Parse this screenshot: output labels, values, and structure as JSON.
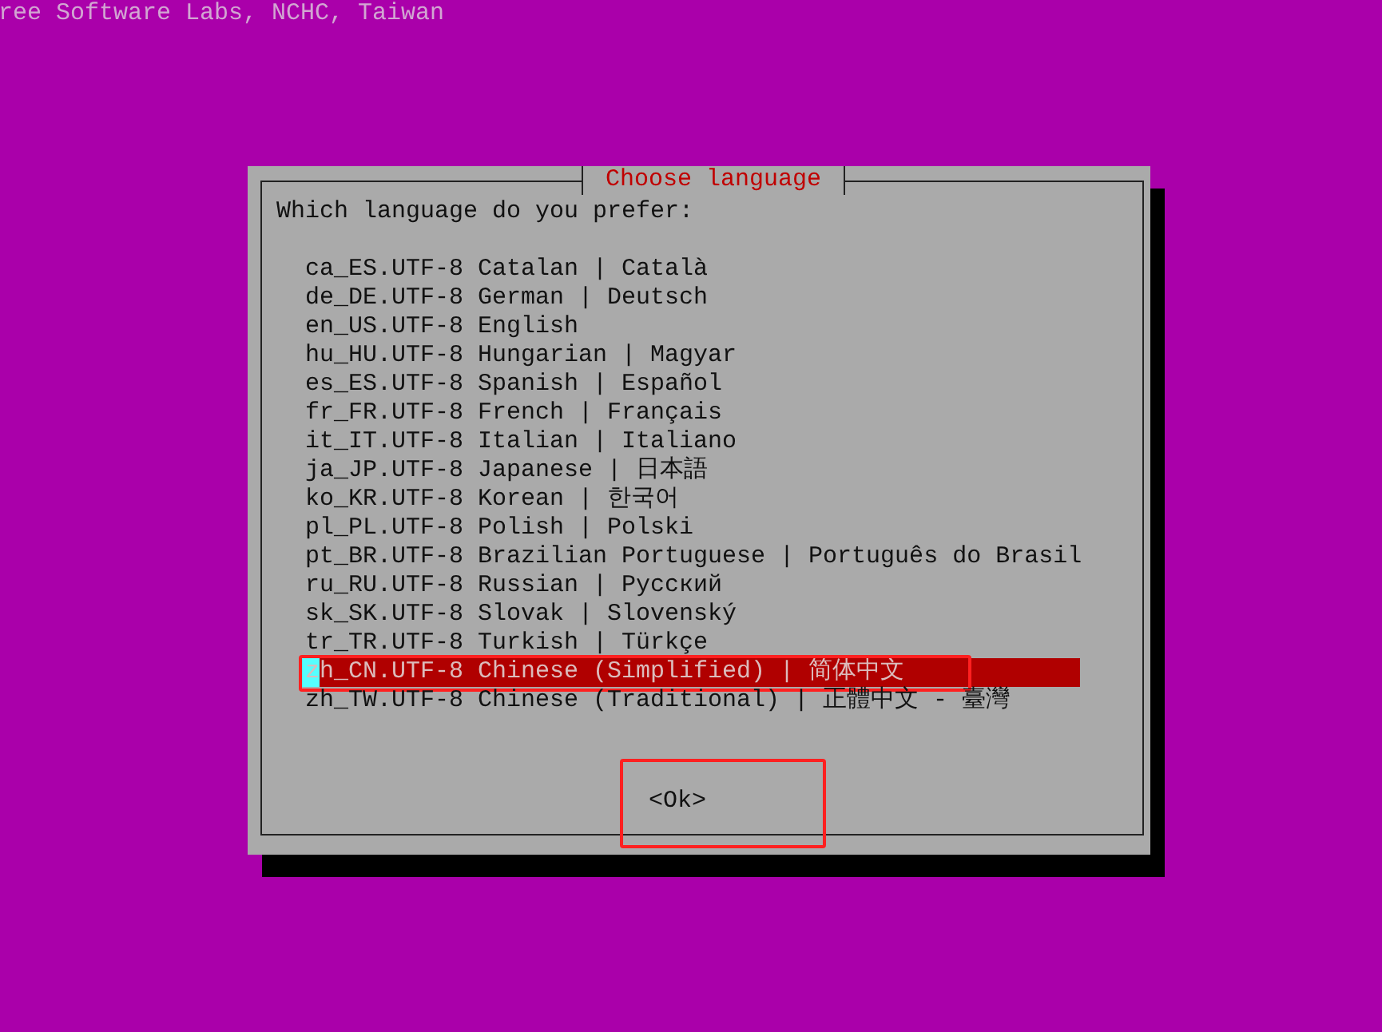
{
  "top_text": "ree Software Labs, NCHC, Taiwan",
  "dialog": {
    "title": "Choose language",
    "question": "Which language do you prefer:",
    "items": [
      {
        "text": "ca_ES.UTF-8 Catalan | Català",
        "selected": false,
        "annotated": false
      },
      {
        "text": "de_DE.UTF-8 German | Deutsch",
        "selected": false,
        "annotated": false
      },
      {
        "text": "en_US.UTF-8 English",
        "selected": false,
        "annotated": false
      },
      {
        "text": "hu_HU.UTF-8 Hungarian | Magyar",
        "selected": false,
        "annotated": false
      },
      {
        "text": "es_ES.UTF-8 Spanish | Español",
        "selected": false,
        "annotated": false
      },
      {
        "text": "fr_FR.UTF-8 French | Français",
        "selected": false,
        "annotated": false
      },
      {
        "text": "it_IT.UTF-8 Italian | Italiano",
        "selected": false,
        "annotated": false
      },
      {
        "text": "ja_JP.UTF-8 Japanese | 日本語",
        "selected": false,
        "annotated": false
      },
      {
        "text": "ko_KR.UTF-8 Korean | 한국어",
        "selected": false,
        "annotated": false
      },
      {
        "text": "pl_PL.UTF-8 Polish | Polski",
        "selected": false,
        "annotated": false
      },
      {
        "text": "pt_BR.UTF-8 Brazilian Portuguese | Português do Brasil",
        "selected": false,
        "annotated": false
      },
      {
        "text": "ru_RU.UTF-8 Russian | Русский",
        "selected": false,
        "annotated": false
      },
      {
        "text": "sk_SK.UTF-8 Slovak | Slovenský",
        "selected": false,
        "annotated": false
      },
      {
        "text": "tr_TR.UTF-8 Turkish | Türkçe",
        "selected": false,
        "annotated": false
      },
      {
        "text": "zh_CN.UTF-8 Chinese (Simplified) | 简体中文",
        "selected": true,
        "annotated": true
      },
      {
        "text": "zh_TW.UTF-8 Chinese (Traditional) | 正體中文 - 臺灣",
        "selected": false,
        "annotated": false
      }
    ],
    "button": {
      "label": "<Ok>",
      "annotated": true
    }
  }
}
